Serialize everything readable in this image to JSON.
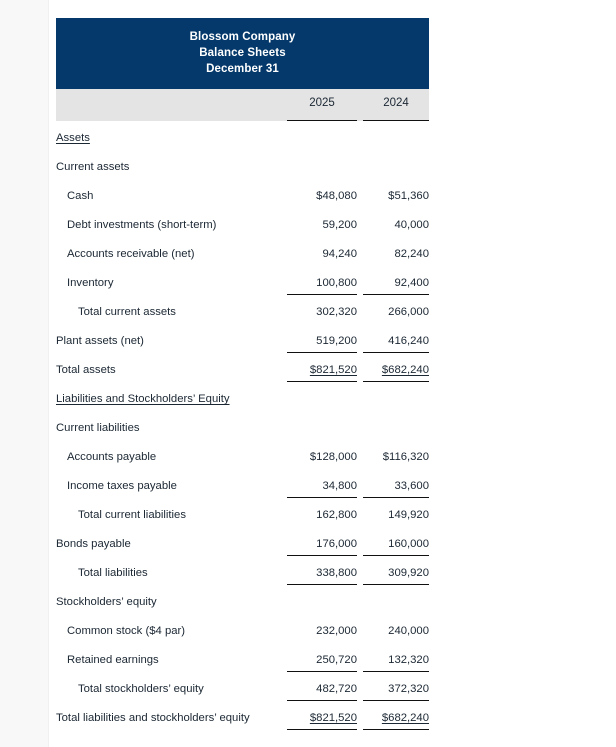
{
  "colors": {
    "title_band": "#05396b",
    "column_header_band": "#e4e4e4",
    "rule": "#111111",
    "text": "#1b2733",
    "page_rail": "#f8f8f9"
  },
  "statement": {
    "company": "Blossom Company",
    "title": "Balance Sheets",
    "date": "December 31",
    "columns": [
      "2025",
      "2024"
    ],
    "rows": [
      {
        "label": "Assets",
        "indent": 0,
        "style": "section",
        "v2025": "",
        "v2024": ""
      },
      {
        "label": "Current assets",
        "indent": 0,
        "style": "plain",
        "v2025": "",
        "v2024": ""
      },
      {
        "label": "Cash",
        "indent": 1,
        "style": "plain",
        "v2025": "$48,080",
        "v2024": "$51,360"
      },
      {
        "label": "Debt investments (short-term)",
        "indent": 1,
        "style": "plain",
        "v2025": "59,200",
        "v2024": "40,000"
      },
      {
        "label": "Accounts receivable (net)",
        "indent": 1,
        "style": "plain",
        "v2025": "94,240",
        "v2024": "82,240"
      },
      {
        "label": "Inventory",
        "indent": 1,
        "style": "rule",
        "v2025": "100,800",
        "v2024": "92,400"
      },
      {
        "label": "Total current assets",
        "indent": 2,
        "style": "plain",
        "v2025": "302,320",
        "v2024": "266,000"
      },
      {
        "label": "Plant assets (net)",
        "indent": 0,
        "style": "rule",
        "v2025": "519,200",
        "v2024": "416,240"
      },
      {
        "label": "Total assets",
        "indent": 0,
        "style": "dbl",
        "v2025": "$821,520",
        "v2024": "$682,240"
      },
      {
        "label": "Liabilities and Stockholders’ Equity",
        "indent": 0,
        "style": "section",
        "v2025": "",
        "v2024": ""
      },
      {
        "label": "Current liabilities",
        "indent": 0,
        "style": "plain",
        "v2025": "",
        "v2024": ""
      },
      {
        "label": "Accounts payable",
        "indent": 1,
        "style": "plain",
        "v2025": "$128,000",
        "v2024": "$116,320"
      },
      {
        "label": "Income taxes payable",
        "indent": 1,
        "style": "rule",
        "v2025": "34,800",
        "v2024": "33,600"
      },
      {
        "label": "Total current liabilities",
        "indent": 2,
        "style": "plain",
        "v2025": "162,800",
        "v2024": "149,920"
      },
      {
        "label": "Bonds payable",
        "indent": 0,
        "style": "rule",
        "v2025": "176,000",
        "v2024": "160,000"
      },
      {
        "label": "Total liabilities",
        "indent": 2,
        "style": "rule",
        "v2025": "338,800",
        "v2024": "309,920"
      },
      {
        "label": "Stockholders’ equity",
        "indent": 0,
        "style": "plain",
        "v2025": "",
        "v2024": ""
      },
      {
        "label": "Common stock ($4 par)",
        "indent": 1,
        "style": "plain",
        "v2025": "232,000",
        "v2024": "240,000"
      },
      {
        "label": "Retained earnings",
        "indent": 1,
        "style": "rule",
        "v2025": "250,720",
        "v2024": "132,320"
      },
      {
        "label": "Total stockholders’ equity",
        "indent": 2,
        "style": "rule",
        "v2025": "482,720",
        "v2024": "372,320"
      },
      {
        "label": "Total liabilities and stockholders’ equity",
        "indent": 0,
        "style": "dbl",
        "v2025": "$821,520",
        "v2024": "$682,240"
      }
    ]
  }
}
